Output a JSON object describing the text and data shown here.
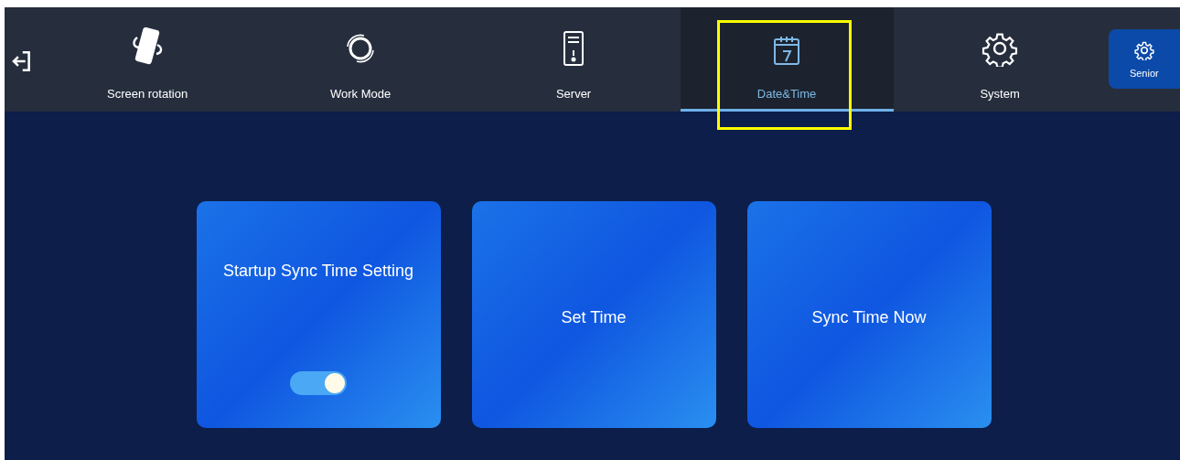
{
  "tabs": [
    {
      "label": "Screen rotation",
      "selected": false,
      "highlighted": false
    },
    {
      "label": "Work Mode",
      "selected": false,
      "highlighted": false
    },
    {
      "label": "Server",
      "selected": false,
      "highlighted": false
    },
    {
      "label": "Date&Time",
      "selected": true,
      "highlighted": true
    },
    {
      "label": "System",
      "selected": false,
      "highlighted": false
    }
  ],
  "senior_button": {
    "label": "Senior"
  },
  "cards": [
    {
      "kind": "toggle",
      "label": "Startup Sync Time Setting",
      "on": true
    },
    {
      "kind": "action",
      "label": "Set Time"
    },
    {
      "kind": "action",
      "label": "Sync Time Now"
    }
  ]
}
